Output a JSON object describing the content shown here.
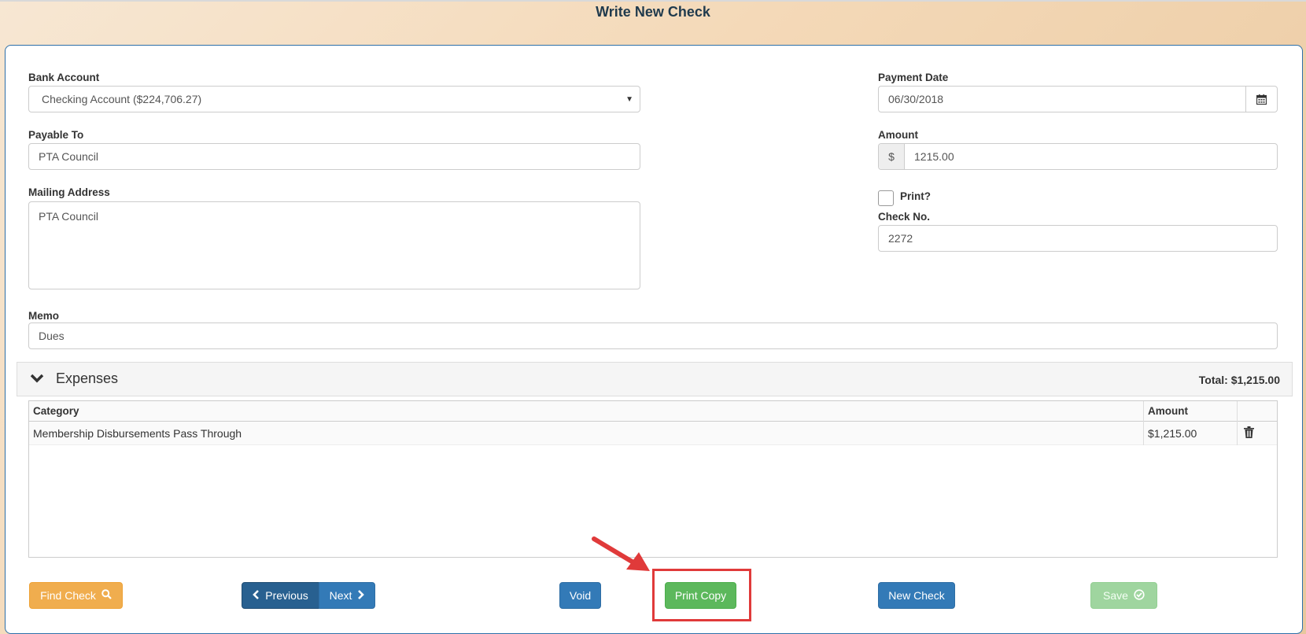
{
  "page": {
    "title": "Write New Check"
  },
  "form": {
    "bank_account": {
      "label": "Bank Account",
      "value": "Checking Account ($224,706.27)"
    },
    "payable_to": {
      "label": "Payable To",
      "value": "PTA Council"
    },
    "mailing_address": {
      "label": "Mailing Address",
      "value": "PTA Council"
    },
    "memo": {
      "label": "Memo",
      "value": "Dues"
    },
    "payment_date": {
      "label": "Payment Date",
      "value": "06/30/2018"
    },
    "amount": {
      "label": "Amount",
      "currency_symbol": "$",
      "value": "1215.00"
    },
    "print": {
      "label": "Print?",
      "checked": false
    },
    "check_no": {
      "label": "Check No.",
      "value": "2272"
    }
  },
  "expenses": {
    "title": "Expenses",
    "total_label": "Total: $1,215.00",
    "columns": [
      "Category",
      "Amount"
    ],
    "rows": [
      {
        "category": "Membership Disbursements Pass Through",
        "amount": "$1,215.00"
      }
    ]
  },
  "buttons": {
    "find_check": "Find Check",
    "previous": "Previous",
    "next": "Next",
    "void": "Void",
    "print_copy": "Print Copy",
    "new_check": "New Check",
    "save": "Save"
  },
  "icons": {
    "calendar": "calendar-icon",
    "search": "search-icon",
    "chevron_left": "chevron-left-icon",
    "chevron_right": "chevron-right-icon",
    "chevron_down": "chevron-down-icon",
    "trash": "trash-icon",
    "check_circle": "check-circle-icon"
  },
  "colors": {
    "title": "#1f3a4d",
    "panel_border": "#2d6fa8",
    "primary": "#337ab7",
    "warning": "#f0ad4e",
    "success": "#5cb85c",
    "highlight": "#e03a3a"
  }
}
